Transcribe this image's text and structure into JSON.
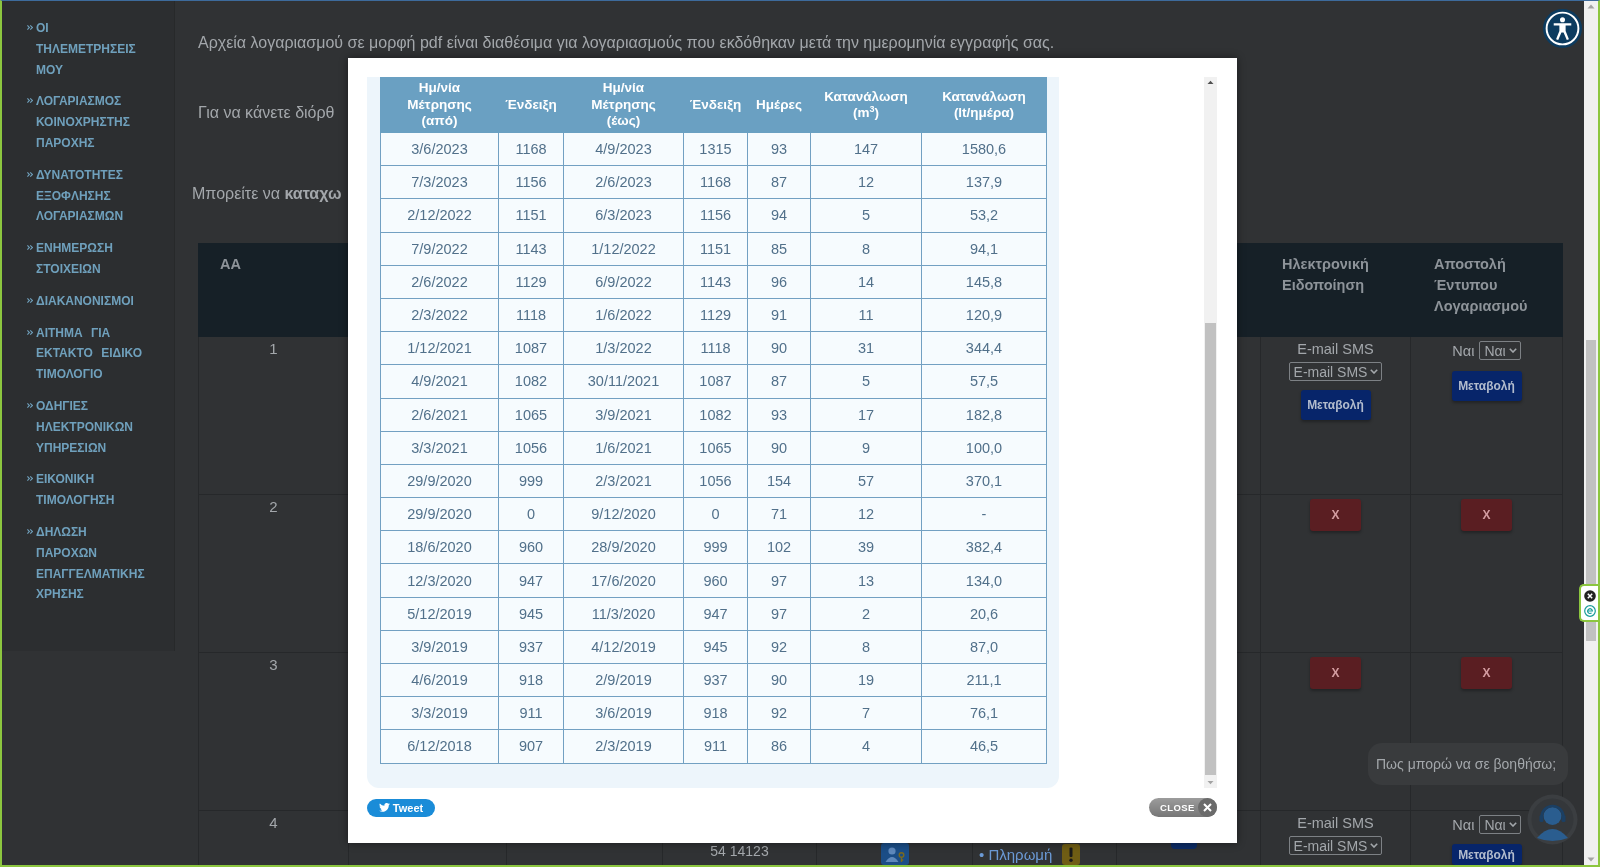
{
  "sidebar": {
    "items": [
      {
        "label": "ΟΙ ΤΗΛΕΜΕΤΡΗΣΕΙΣ ΜΟΥ"
      },
      {
        "label": "ΛΟΓΑΡΙΑΣΜΟΣ ΚΟΙΝΟΧΡΗΣΤΗΣ ΠΑΡΟΧΗΣ"
      },
      {
        "label": "ΔΥΝΑΤΟΤΗΤΕΣ ΕΞΟΦΛΗΣΗΣ ΛΟΓΑΡΙΑΣΜΩΝ"
      },
      {
        "label": "ΕΝΗΜΕΡΩΣΗ ΣΤΟΙΧΕΙΩΝ"
      },
      {
        "label": "ΔΙΑΚΑΝΟΝΙΣΜΟΙ"
      },
      {
        "label": "ΑΙΤΗΜΑ ΓΙΑ ΕΚΤΑΚΤΟ ΕΙΔΙΚΟ ΤΙΜΟΛΟΓΙΟ"
      },
      {
        "label": "ΟΔΗΓΙΕΣ ΗΛΕΚΤΡΟΝΙΚΩΝ ΥΠΗΡΕΣΙΩΝ"
      },
      {
        "label": "ΕΙΚΟΝΙΚΗ ΤΙΜΟΛΟΓΗΣΗ"
      },
      {
        "label": "ΔΗΛΩΣΗ ΠΑΡΟΧΩΝ ΕΠΑΓΓΕΛΜΑΤΙΚΗΣ ΧΡΗΣΗΣ"
      }
    ]
  },
  "intro": {
    "pdf_note": "Αρχεία λογαριασμού σε μορφή pdf είναι διαθέσιμα για λογαριασμούς που εκδόθηκαν μετά την ημερομηνία εγγραφής σας.",
    "correction_note": "Για να κάνετε διόρθ",
    "register_note": "Μπορείτε να **καταχω**"
  },
  "accounts_table": {
    "header": {
      "number": "ΑΑ",
      "notification": "Ηλεκτρονική Ειδοποίηση",
      "printed_bill": "Αποστολή Έντυπου Λογαριασμού"
    },
    "rows": [
      {
        "number": "1",
        "notification": {
          "kind": "form",
          "current": "E-mail SMS",
          "choice": "E-mail SMS",
          "button": "Μεταβολή"
        },
        "printed_bill": {
          "kind": "form",
          "current": "Ναι",
          "choice": "Ναι",
          "button": "Μεταβολή"
        }
      },
      {
        "number": "2",
        "notification": {
          "kind": "remove",
          "button": "X"
        },
        "printed_bill": {
          "kind": "remove",
          "button": "X"
        }
      },
      {
        "number": "3",
        "notification": {
          "kind": "remove",
          "button": "X"
        },
        "printed_bill": {
          "kind": "remove",
          "button": "X"
        }
      },
      {
        "number": "4",
        "code": "54 14123",
        "payment_link": "• Πληρωμή",
        "notification": {
          "kind": "form",
          "current": "E-mail SMS",
          "choice": "E-mail SMS"
        },
        "printed_bill": {
          "kind": "form",
          "current": "Ναι",
          "choice": "Ναι",
          "button": "Μεταβολή"
        }
      }
    ]
  },
  "chat": {
    "prompt": "Πως μπορώ να σε βοηθήσω;"
  },
  "modal": {
    "table": {
      "columns": [
        "Ημ/νία Μέτρησης (από)",
        "Ένδειξη",
        "Ημ/νία Μέτρησης (έως)",
        "Ένδειξη",
        "Ημέρες",
        "Κατανάλωση (m$^{3}$)",
        "Κατανάλωση (lt/ημέρα)"
      ],
      "rows": [
        [
          "3/6/2023",
          "1168",
          "4/9/2023",
          "1315",
          "93",
          "147",
          "1580,6"
        ],
        [
          "7/3/2023",
          "1156",
          "2/6/2023",
          "1168",
          "87",
          "12",
          "137,9"
        ],
        [
          "2/12/2022",
          "1151",
          "6/3/2023",
          "1156",
          "94",
          "5",
          "53,2"
        ],
        [
          "7/9/2022",
          "1143",
          "1/12/2022",
          "1151",
          "85",
          "8",
          "94,1"
        ],
        [
          "2/6/2022",
          "1129",
          "6/9/2022",
          "1143",
          "96",
          "14",
          "145,8"
        ],
        [
          "2/3/2022",
          "1118",
          "1/6/2022",
          "1129",
          "91",
          "11",
          "120,9"
        ],
        [
          "1/12/2021",
          "1087",
          "1/3/2022",
          "1118",
          "90",
          "31",
          "344,4"
        ],
        [
          "4/9/2021",
          "1082",
          "30/11/2021",
          "1087",
          "87",
          "5",
          "57,5"
        ],
        [
          "2/6/2021",
          "1065",
          "3/9/2021",
          "1082",
          "93",
          "17",
          "182,8"
        ],
        [
          "3/3/2021",
          "1056",
          "1/6/2021",
          "1065",
          "90",
          "9",
          "100,0"
        ],
        [
          "29/9/2020",
          "999",
          "2/3/2021",
          "1056",
          "154",
          "57",
          "370,1"
        ],
        [
          "29/9/2020",
          "0",
          "9/12/2020",
          "0",
          "71",
          "12",
          "-"
        ],
        [
          "18/6/2020",
          "960",
          "28/9/2020",
          "999",
          "102",
          "39",
          "382,4"
        ],
        [
          "12/3/2020",
          "947",
          "17/6/2020",
          "960",
          "97",
          "13",
          "134,0"
        ],
        [
          "5/12/2019",
          "945",
          "11/3/2020",
          "947",
          "97",
          "2",
          "20,6"
        ],
        [
          "3/9/2019",
          "937",
          "4/12/2019",
          "945",
          "92",
          "8",
          "87,0"
        ],
        [
          "4/6/2019",
          "918",
          "2/9/2019",
          "937",
          "90",
          "19",
          "211,1"
        ],
        [
          "3/3/2019",
          "911",
          "3/6/2019",
          "918",
          "92",
          "7",
          "76,1"
        ],
        [
          "6/12/2018",
          "907",
          "2/3/2019",
          "911",
          "86",
          "4",
          "46,5"
        ]
      ]
    },
    "tweet_button": "Tweet",
    "close_button": "CLOSE"
  }
}
